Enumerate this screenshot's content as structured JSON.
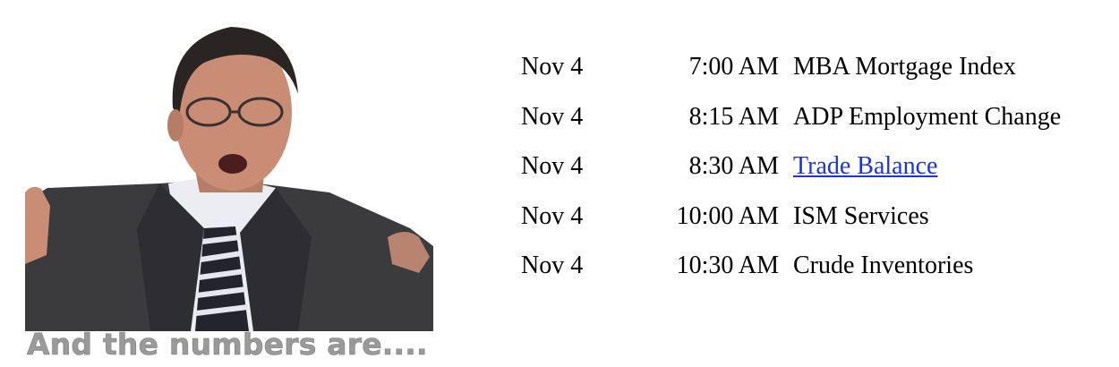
{
  "caption": "And the numbers are....",
  "events": [
    {
      "date": "Nov 4",
      "time": "7:00 AM",
      "name": "MBA Mortgage Index",
      "link": false
    },
    {
      "date": "Nov 4",
      "time": "8:15 AM",
      "name": "ADP Employment Change",
      "link": false
    },
    {
      "date": "Nov 4",
      "time": "8:30 AM",
      "name": "Trade Balance",
      "link": true
    },
    {
      "date": "Nov 4",
      "time": "10:00 AM",
      "name": "ISM Services",
      "link": false
    },
    {
      "date": "Nov 4",
      "time": "10:30 AM",
      "name": "Crude Inventories",
      "link": false
    }
  ],
  "colors": {
    "link": "#1a33e6",
    "caption": "#9a9a9a",
    "suit": "#3b3b3e",
    "shirt": "#ecedf2",
    "skin": "#c98d75"
  }
}
